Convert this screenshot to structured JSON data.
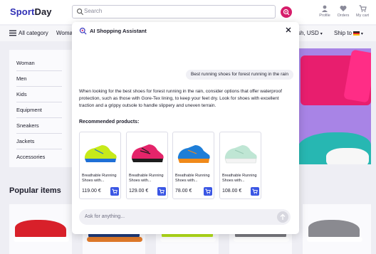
{
  "header": {
    "logo_part1": "Sport",
    "logo_part2": "Day",
    "search_placeholder": "Search",
    "profile_label": "Profile",
    "orders_label": "Orders",
    "cart_label": "My cart"
  },
  "nav": {
    "all_category": "All category",
    "women_partial": "Womar",
    "currency": "sh, USD",
    "ship_to": "Ship to"
  },
  "sidebar": {
    "items": [
      {
        "label": "Woman"
      },
      {
        "label": "Men"
      },
      {
        "label": "Kids"
      },
      {
        "label": "Equipment"
      },
      {
        "label": "Sneakers"
      },
      {
        "label": "Jackets"
      },
      {
        "label": "Accessories"
      }
    ]
  },
  "main": {
    "popular_title": "Popular items"
  },
  "assistant": {
    "title": "AI Shopping Assistant",
    "user_message": "Best running shoes for forest running in the rain",
    "answer": "When looking for the best shoes for forest running in the rain, consider options that offer waterproof protection, such as those with Gore-Tex lining, to keep your feet dry. Look for shoes with excellent traction and a grippy outsole to handle slippery and uneven terrain.",
    "recommended_title": "Recommended products:",
    "products": [
      {
        "name": "Breathable Running Shoes with...",
        "price": "119.00 €",
        "color": "#c7ea1a",
        "accent": "#1f6fd6"
      },
      {
        "name": "Breathable Running Shoes with...",
        "price": "129.00 €",
        "color": "#e4246a",
        "accent": "#1d1d1d"
      },
      {
        "name": "Breathable Running Shoes with...",
        "price": "78.00 €",
        "color": "#1e7ed8",
        "accent": "#f08a1a"
      },
      {
        "name": "Breathable Running Shoes with...",
        "price": "108.00 €",
        "color": "#bfe6d4",
        "accent": "#ffffff"
      }
    ],
    "input_placeholder": "Ask for anything..."
  },
  "colors": {
    "brand_blue": "#2f2fb5",
    "ai_button": "#d61d6a",
    "cart_button": "#3a56e4"
  }
}
